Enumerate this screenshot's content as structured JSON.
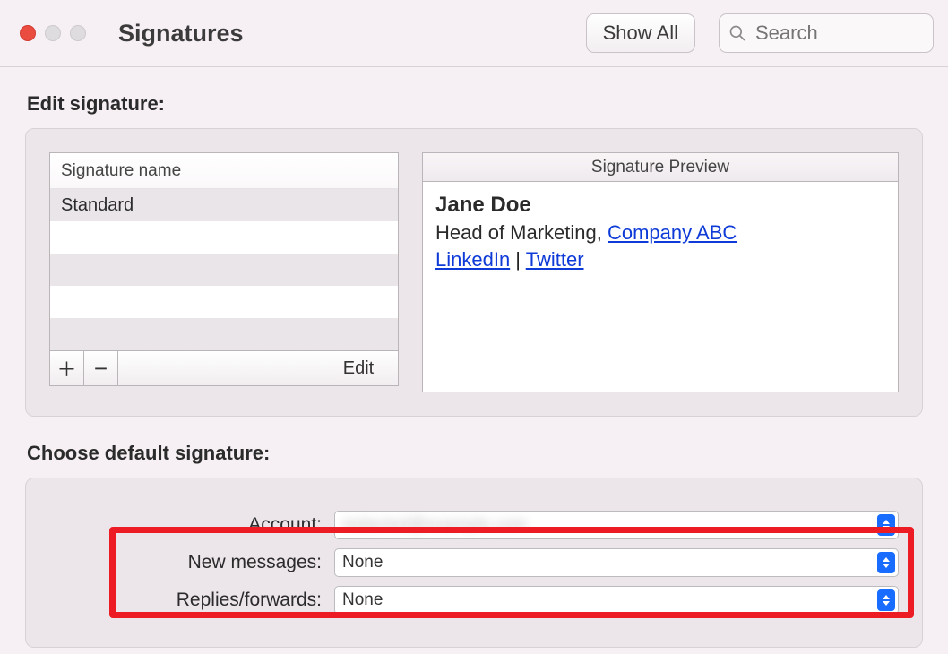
{
  "window": {
    "title": "Signatures",
    "show_all": "Show All",
    "search_placeholder": "Search"
  },
  "labels": {
    "edit_section": "Edit signature:",
    "choose_section": "Choose default signature:",
    "column_header": "Signature name",
    "preview_header": "Signature Preview",
    "add": "＋",
    "remove": "−",
    "edit": "Edit",
    "account": "Account:",
    "new_messages": "New messages:",
    "replies": "Replies/forwards:"
  },
  "signatures": {
    "items": [
      "Standard"
    ],
    "blank_rows": 4
  },
  "preview": {
    "name": "Jane Doe",
    "role": "Head of Marketing, ",
    "company": "Company ABC",
    "links": {
      "linkedin": "LinkedIn",
      "twitter": "Twitter"
    },
    "sep": " | "
  },
  "defaults": {
    "account_value": "redacted@example.com",
    "new_messages_value": "None",
    "replies_value": "None"
  }
}
